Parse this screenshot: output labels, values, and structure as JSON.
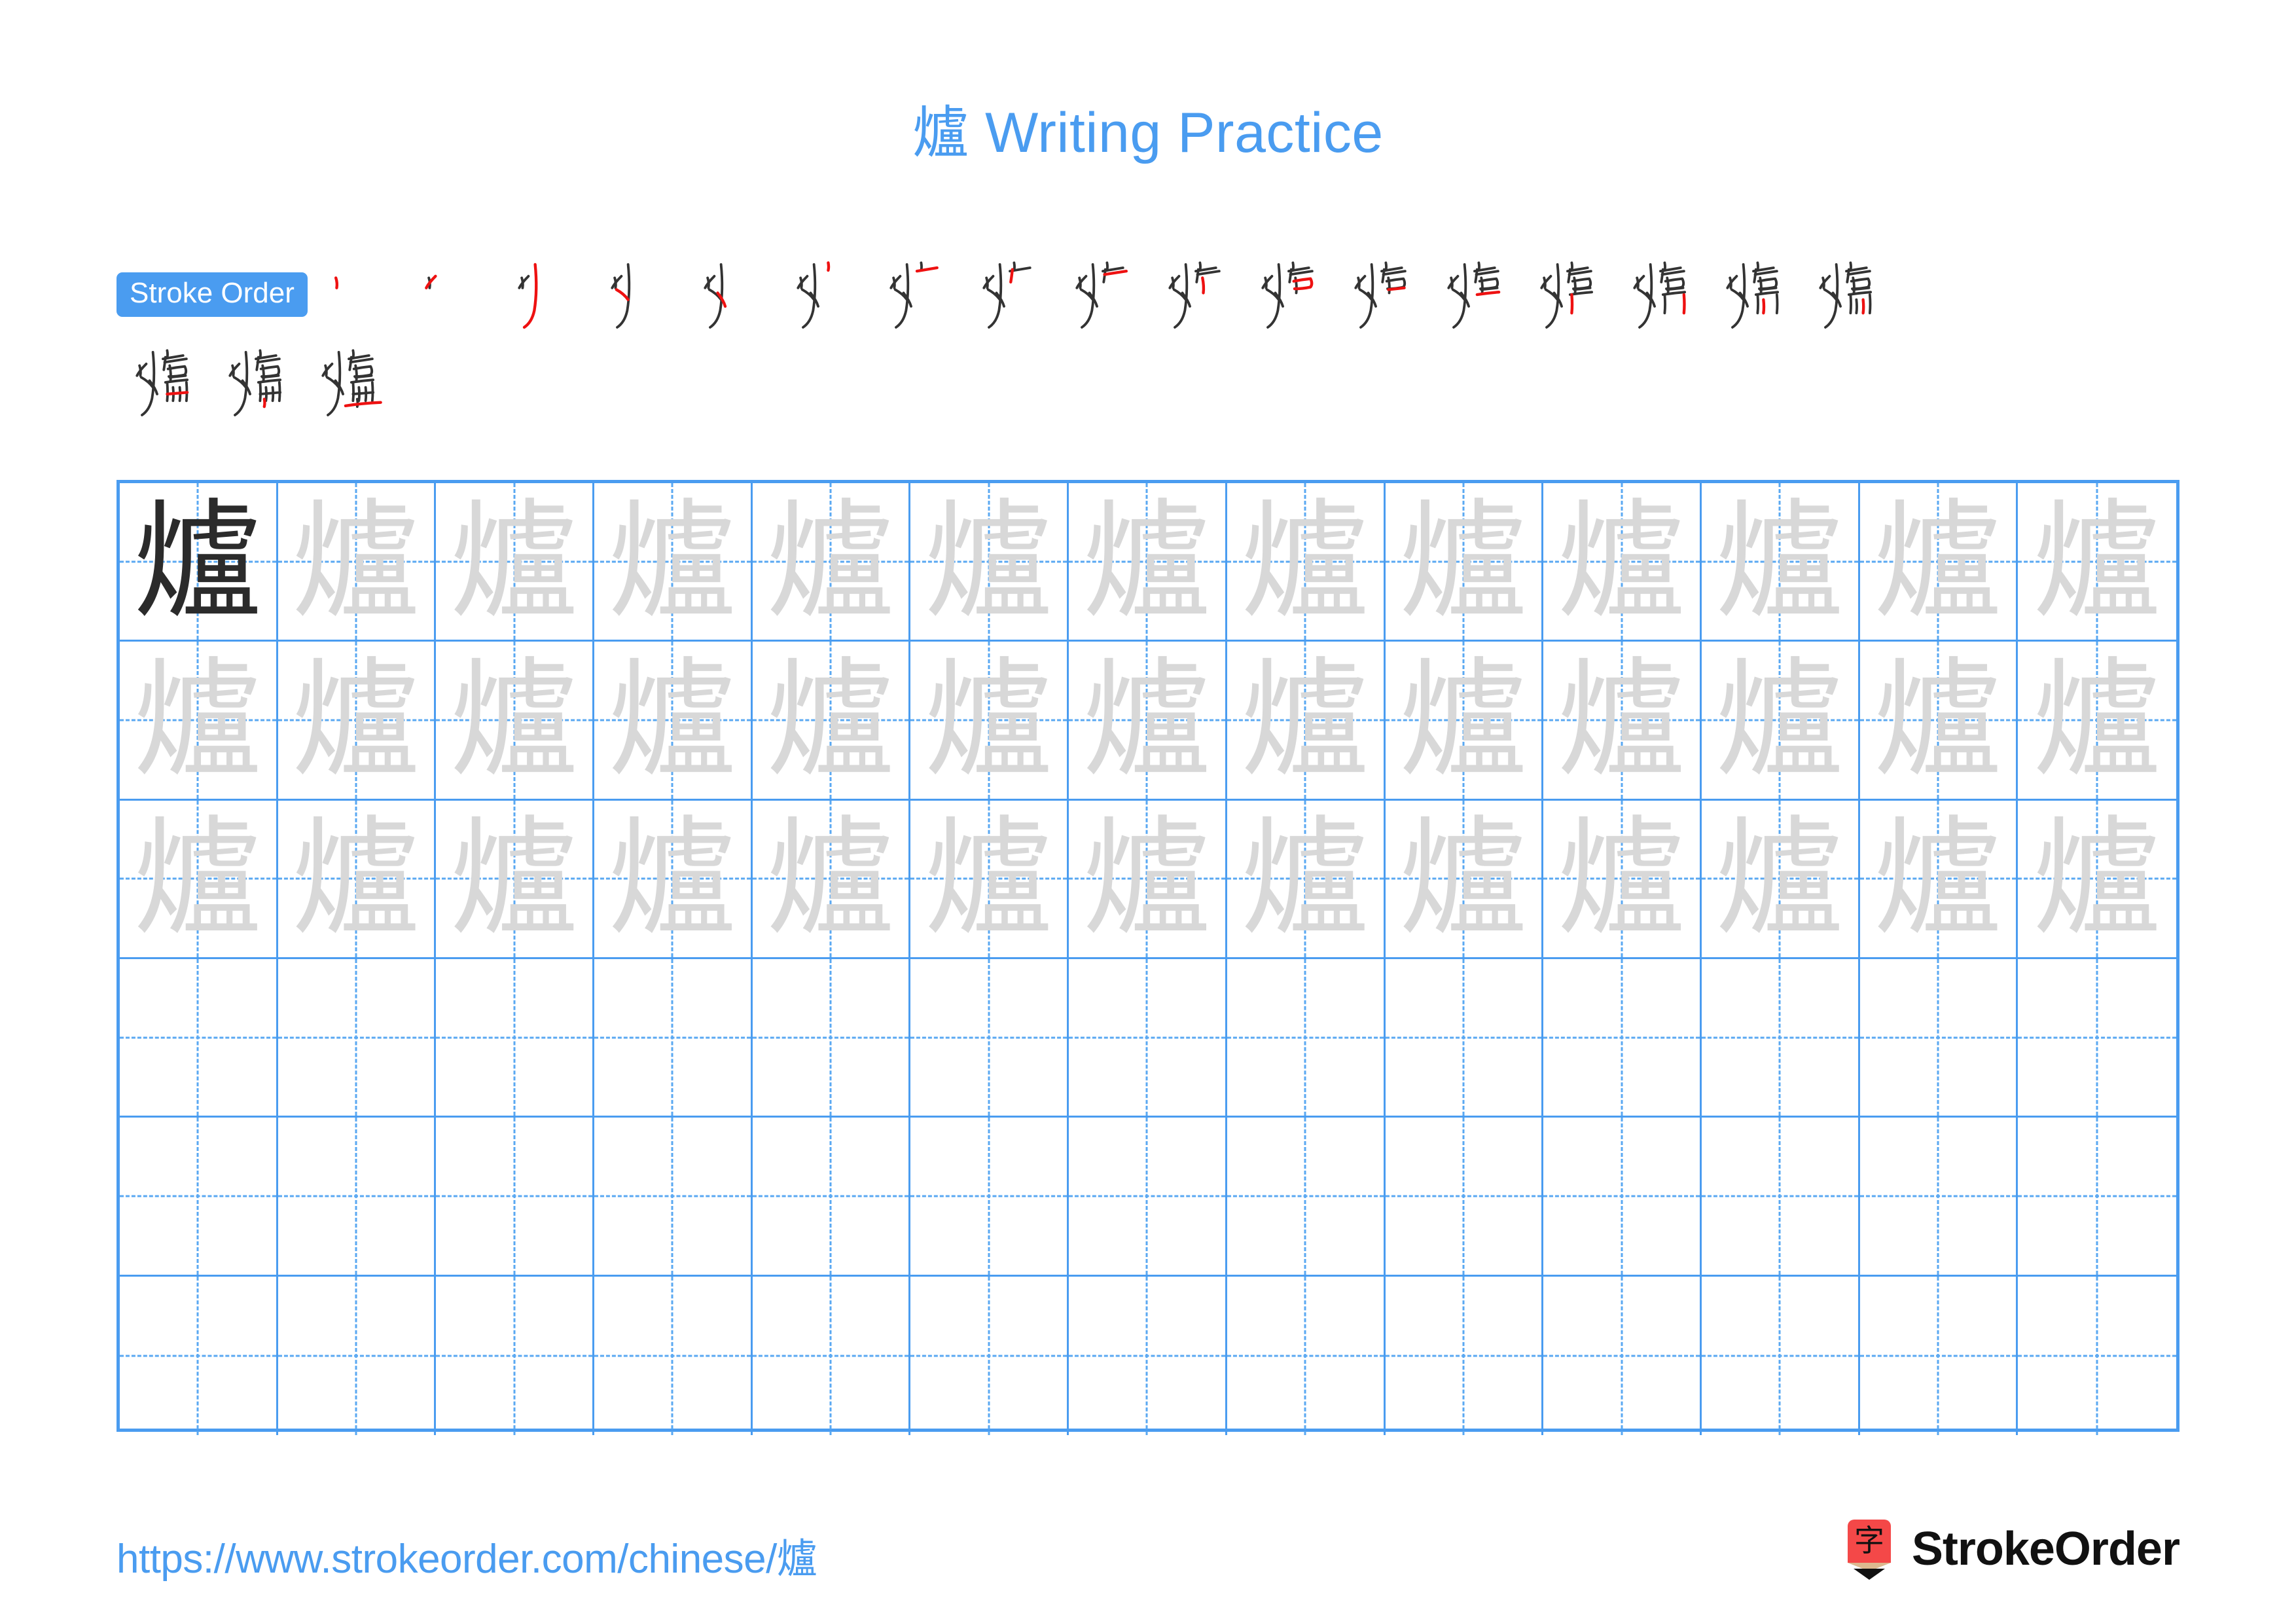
{
  "meta": {
    "character": "爐",
    "total_strokes": 20
  },
  "header": {
    "title_char": "爐",
    "title_text": " Writing Practice",
    "title_full": "爐 Writing Practice",
    "title_color": "#4a9cf0"
  },
  "stroke_order": {
    "badge_label": "Stroke Order",
    "badge_bg": "#4a9cf0",
    "badge_text_color": "#ffffff",
    "new_stroke_color": "#ee1111",
    "prior_stroke_color": "#333333",
    "row1_count": 17,
    "row2_count": 3,
    "steps": [
      {
        "index": 1,
        "strokes": 1
      },
      {
        "index": 2,
        "strokes": 2
      },
      {
        "index": 3,
        "strokes": 3
      },
      {
        "index": 4,
        "strokes": 4
      },
      {
        "index": 5,
        "strokes": 5
      },
      {
        "index": 6,
        "strokes": 6
      },
      {
        "index": 7,
        "strokes": 7
      },
      {
        "index": 8,
        "strokes": 8
      },
      {
        "index": 9,
        "strokes": 9
      },
      {
        "index": 10,
        "strokes": 10
      },
      {
        "index": 11,
        "strokes": 11
      },
      {
        "index": 12,
        "strokes": 12
      },
      {
        "index": 13,
        "strokes": 13
      },
      {
        "index": 14,
        "strokes": 14
      },
      {
        "index": 15,
        "strokes": 15
      },
      {
        "index": 16,
        "strokes": 16
      },
      {
        "index": 17,
        "strokes": 17
      },
      {
        "index": 18,
        "strokes": 18
      },
      {
        "index": 19,
        "strokes": 19
      },
      {
        "index": 20,
        "strokes": 20
      }
    ]
  },
  "practice_grid": {
    "columns": 13,
    "rows": 6,
    "grid_line_color": "#4a9cf0",
    "guide_line_color": "#5aa8f2",
    "model_char_color": "#2b2b2b",
    "trace_char_color": "#d8d8d8",
    "cells": [
      [
        "model",
        "trace",
        "trace",
        "trace",
        "trace",
        "trace",
        "trace",
        "trace",
        "trace",
        "trace",
        "trace",
        "trace",
        "trace"
      ],
      [
        "trace",
        "trace",
        "trace",
        "trace",
        "trace",
        "trace",
        "trace",
        "trace",
        "trace",
        "trace",
        "trace",
        "trace",
        "trace"
      ],
      [
        "trace",
        "trace",
        "trace",
        "trace",
        "trace",
        "trace",
        "trace",
        "trace",
        "trace",
        "trace",
        "trace",
        "trace",
        "trace"
      ],
      [
        "blank",
        "blank",
        "blank",
        "blank",
        "blank",
        "blank",
        "blank",
        "blank",
        "blank",
        "blank",
        "blank",
        "blank",
        "blank"
      ],
      [
        "blank",
        "blank",
        "blank",
        "blank",
        "blank",
        "blank",
        "blank",
        "blank",
        "blank",
        "blank",
        "blank",
        "blank",
        "blank"
      ],
      [
        "blank",
        "blank",
        "blank",
        "blank",
        "blank",
        "blank",
        "blank",
        "blank",
        "blank",
        "blank",
        "blank",
        "blank",
        "blank"
      ]
    ]
  },
  "footer": {
    "url_prefix": "https://www.strokeorder.com/chinese/",
    "url_char": "爐",
    "url_full": "https://www.strokeorder.com/chinese/爐",
    "url_color": "#4a9cf0",
    "brand_name": "StrokeOrder",
    "logo_char": "字",
    "logo_bg_color": "#f44848",
    "logo_tip_color": "#dcb98f"
  }
}
